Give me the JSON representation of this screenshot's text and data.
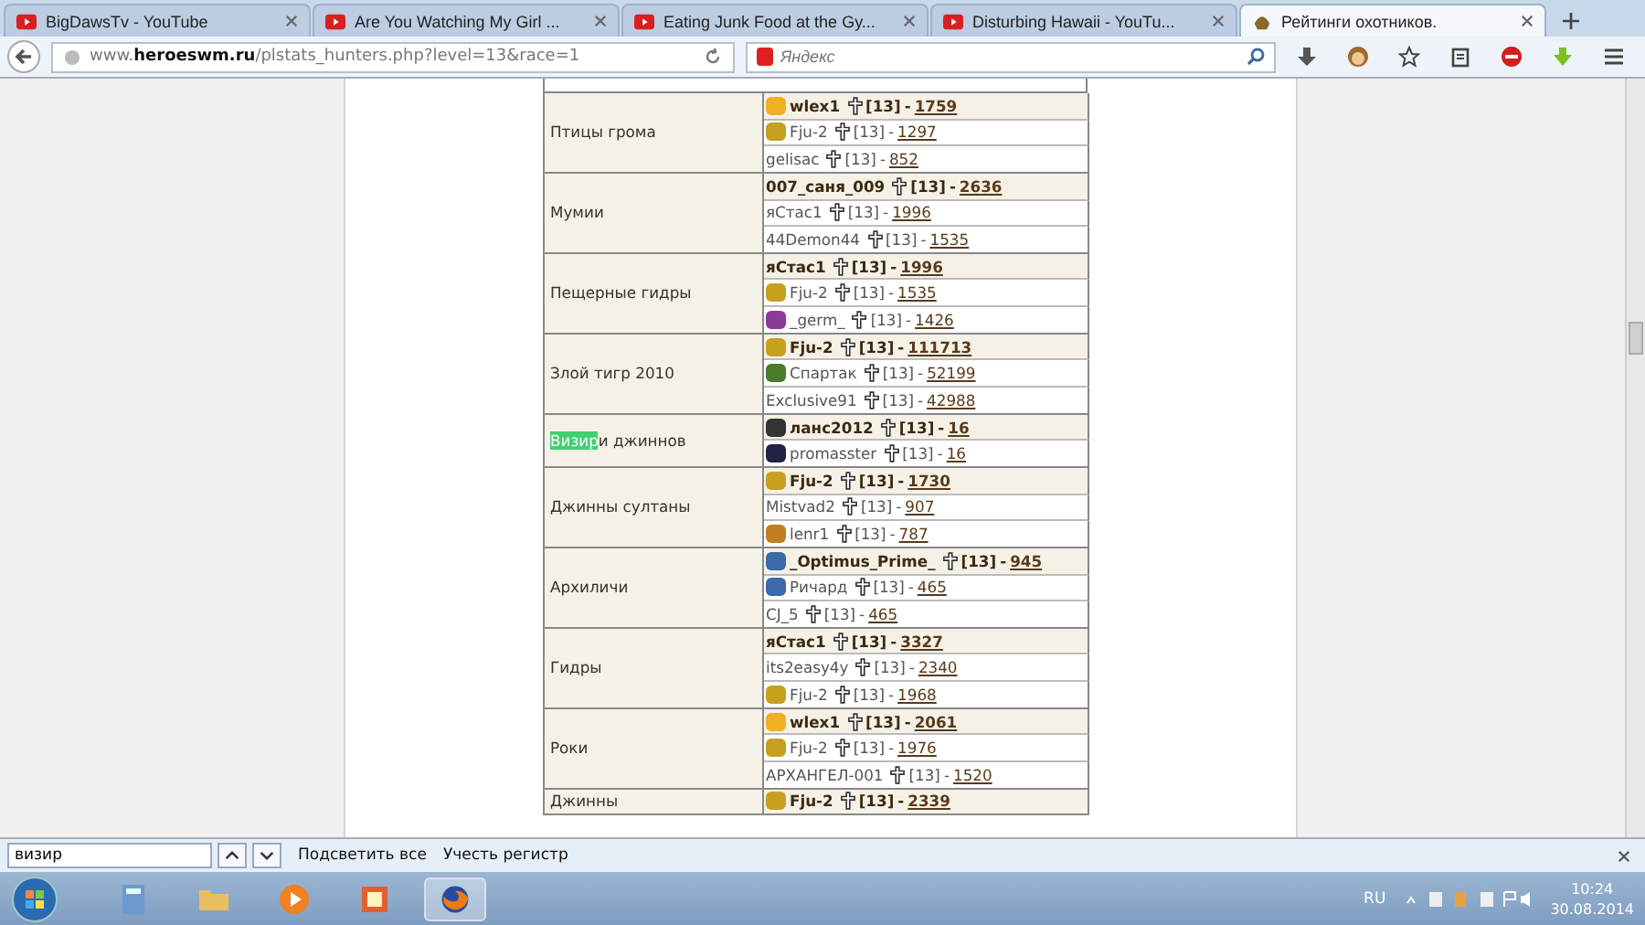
{
  "tabs": [
    {
      "title": "BigDawsTv - YouTube",
      "selected": false
    },
    {
      "title": "Are You Watching My Girl ...",
      "selected": false
    },
    {
      "title": "Eating Junk Food at the Gy...",
      "selected": false
    },
    {
      "title": "Disturbing Hawaii - YouTu...",
      "selected": false
    },
    {
      "title": "Рейтинги охотников.",
      "selected": true
    }
  ],
  "address_bar": {
    "prefix": "www.",
    "domain": "heroeswm.ru",
    "path": "/plstats_hunters.php?level=13&race=1"
  },
  "search": {
    "placeholder": "Яндекс"
  },
  "groups": [
    {
      "name": [
        {
          "text": "Птицы грома",
          "highlighted": false
        }
      ],
      "entries": [
        {
          "kind": "smiley",
          "player": "wlex1",
          "level": "[13]",
          "dash": "-",
          "score": "1759",
          "leader": true
        },
        {
          "kind": "trophy",
          "player": "Fju-2",
          "level": "[13]",
          "dash": "-",
          "score": "1297",
          "leader": false
        },
        {
          "kind": "plain",
          "player": "gelisac",
          "level": "[13]",
          "dash": "-",
          "score": "852",
          "leader": false
        }
      ]
    },
    {
      "name": [
        {
          "text": "Мумии",
          "highlighted": false
        }
      ],
      "entries": [
        {
          "kind": "plain",
          "player": "007_саня_009",
          "level": "[13]",
          "dash": "-",
          "score": "2636",
          "leader": true
        },
        {
          "kind": "plain",
          "player": "яСтас1",
          "level": "[13]",
          "dash": "-",
          "score": "1996",
          "leader": false
        },
        {
          "kind": "plain",
          "player": "44Demon44",
          "level": "[13]",
          "dash": "-",
          "score": "1535",
          "leader": false
        }
      ]
    },
    {
      "name": [
        {
          "text": "Пещерные гидры",
          "highlighted": false
        }
      ],
      "entries": [
        {
          "kind": "plain",
          "player": "яСтас1",
          "level": "[13]",
          "dash": "-",
          "score": "1996",
          "leader": true
        },
        {
          "kind": "trophy",
          "player": "Fju-2",
          "level": "[13]",
          "dash": "-",
          "score": "1535",
          "leader": false
        },
        {
          "kind": "flag",
          "player": "_germ_",
          "level": "[13]",
          "dash": "-",
          "score": "1426",
          "leader": false
        }
      ]
    },
    {
      "name": [
        {
          "text": "Злой тигр 2010",
          "highlighted": false
        }
      ],
      "entries": [
        {
          "kind": "trophy",
          "player": "Fju-2",
          "level": "[13]",
          "dash": "-",
          "score": "111713",
          "leader": true
        },
        {
          "kind": "tiger",
          "player": "Спартак",
          "level": "[13]",
          "dash": "-",
          "score": "52199",
          "leader": false
        },
        {
          "kind": "plain",
          "player": "Exclusive91",
          "level": "[13]",
          "dash": "-",
          "score": "42988",
          "leader": false
        }
      ]
    },
    {
      "name": [
        {
          "text": "Визир",
          "highlighted": true
        },
        {
          "text": "и джиннов",
          "highlighted": false
        }
      ],
      "entries": [
        {
          "kind": "horse",
          "player": "ланс2012",
          "level": "[13]",
          "dash": "-",
          "score": "16",
          "leader": true
        },
        {
          "kind": "bat",
          "player": "promasster",
          "level": "[13]",
          "dash": "-",
          "score": "16",
          "leader": false
        }
      ]
    },
    {
      "name": [
        {
          "text": "Джинны султаны",
          "highlighted": false
        }
      ],
      "entries": [
        {
          "kind": "trophy",
          "player": "Fju-2",
          "level": "[13]",
          "dash": "-",
          "score": "1730",
          "leader": true
        },
        {
          "kind": "plain",
          "player": "Mistvad2",
          "level": "[13]",
          "dash": "-",
          "score": "907",
          "leader": false
        },
        {
          "kind": "bow",
          "player": "lenr1",
          "level": "[13]",
          "dash": "-",
          "score": "787",
          "leader": false
        }
      ]
    },
    {
      "name": [
        {
          "text": "Архиличи",
          "highlighted": false
        }
      ],
      "entries": [
        {
          "kind": "robot",
          "player": "_Optimus_Prime_",
          "level": "[13]",
          "dash": "-",
          "score": "945",
          "leader": true
        },
        {
          "kind": "robot",
          "player": "Ричард",
          "level": "[13]",
          "dash": "-",
          "score": "465",
          "leader": false
        },
        {
          "kind": "plain",
          "player": "CJ_5",
          "level": "[13]",
          "dash": "-",
          "score": "465",
          "leader": false
        }
      ]
    },
    {
      "name": [
        {
          "text": "Гидры",
          "highlighted": false
        }
      ],
      "entries": [
        {
          "kind": "plain",
          "player": "яСтас1",
          "level": "[13]",
          "dash": "-",
          "score": "3327",
          "leader": true
        },
        {
          "kind": "plain",
          "player": "its2easy4y",
          "level": "[13]",
          "dash": "-",
          "score": "2340",
          "leader": false
        },
        {
          "kind": "trophy",
          "player": "Fju-2",
          "level": "[13]",
          "dash": "-",
          "score": "1968",
          "leader": false
        }
      ]
    },
    {
      "name": [
        {
          "text": "Роки",
          "highlighted": false
        }
      ],
      "entries": [
        {
          "kind": "smiley",
          "player": "wlex1",
          "level": "[13]",
          "dash": "-",
          "score": "2061",
          "leader": true
        },
        {
          "kind": "trophy",
          "player": "Fju-2",
          "level": "[13]",
          "dash": "-",
          "score": "1976",
          "leader": false
        },
        {
          "kind": "plain",
          "player": "АРХАНГЕЛ-001",
          "level": "[13]",
          "dash": "-",
          "score": "1520",
          "leader": false
        }
      ]
    },
    {
      "name": [
        {
          "text": "Джинны",
          "highlighted": false
        }
      ],
      "entries": [
        {
          "kind": "trophy",
          "player": "Fju-2",
          "level": "[13]",
          "dash": "-",
          "score": "2339",
          "leader": true
        }
      ]
    }
  ],
  "find_bar": {
    "query": "визир",
    "highlight_all": "Подсветить все",
    "match_case": "Учесть регистр"
  },
  "taskbar": {
    "language": "RU",
    "time": "10:24",
    "date": "30.08.2014"
  }
}
